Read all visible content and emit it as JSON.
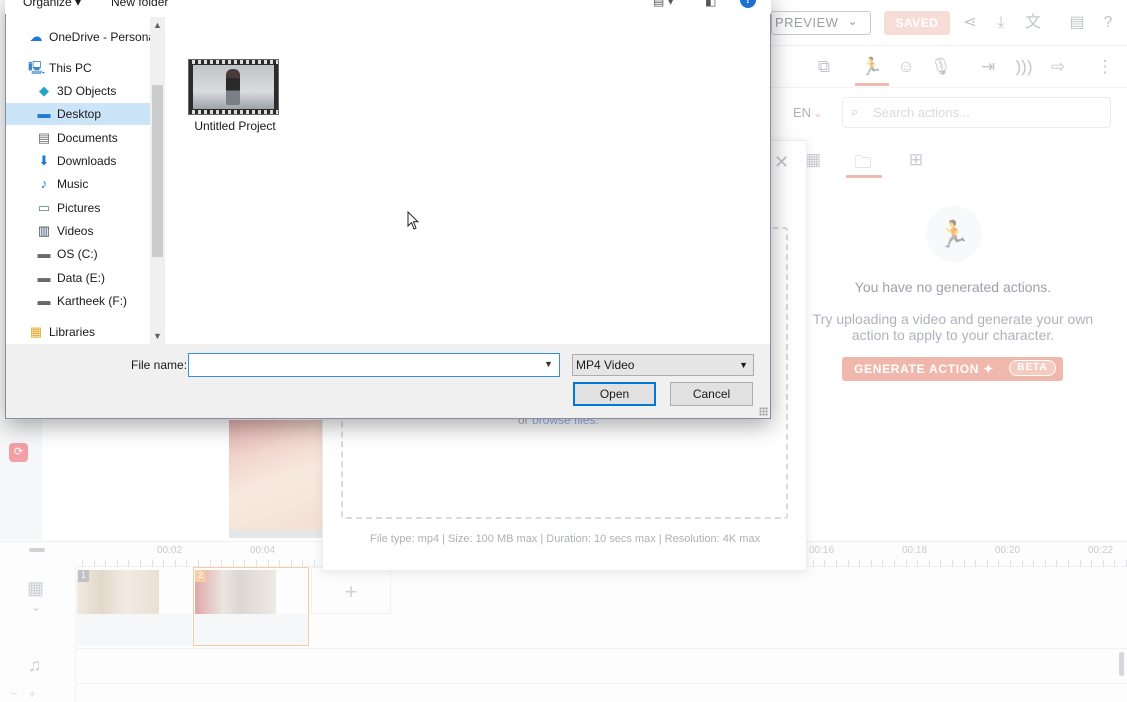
{
  "app": {
    "topbar": {
      "preview_label": "PREVIEW",
      "saved_label": "SAVED"
    },
    "actions_panel": {
      "language": "EN",
      "search_placeholder": "Search actions...",
      "empty_title": "You have no generated actions.",
      "empty_subtitle": "Try uploading a video and generate your own action to apply to your character.",
      "generate_label": "GENERATE ACTION",
      "beta_label": "BETA"
    },
    "upload_modal": {
      "browse_prefix": "or",
      "browse_link": "browse files.",
      "file_constraints": "File type: mp4 | Size: 100 MB max | Duration: 10 secs max | Resolution: 4K max"
    },
    "timeline": {
      "ruler_labels": [
        "00:02",
        "00:04",
        "00:16",
        "00:18",
        "00:20",
        "00:22"
      ],
      "clips": [
        {
          "number": "1"
        },
        {
          "number": "2"
        }
      ]
    }
  },
  "dialog": {
    "commands": {
      "organize": "Organize",
      "new_folder": "New folder"
    },
    "nav_items": [
      {
        "label": "OneDrive - Personal",
        "icon": "cloud-icon"
      },
      {
        "label": "This PC",
        "icon": "computer-icon"
      },
      {
        "label": "3D Objects",
        "icon": "cube-icon"
      },
      {
        "label": "Desktop",
        "icon": "desktop-icon",
        "selected": true
      },
      {
        "label": "Documents",
        "icon": "document-icon"
      },
      {
        "label": "Downloads",
        "icon": "download-arrow-icon"
      },
      {
        "label": "Music",
        "icon": "music-note-icon"
      },
      {
        "label": "Pictures",
        "icon": "picture-icon"
      },
      {
        "label": "Videos",
        "icon": "film-icon"
      },
      {
        "label": "OS (C:)",
        "icon": "drive-icon"
      },
      {
        "label": "Data (E:)",
        "icon": "drive-icon"
      },
      {
        "label": "Kartheek  (F:)",
        "icon": "drive-icon"
      },
      {
        "label": "Libraries",
        "icon": "library-icon"
      }
    ],
    "files": [
      {
        "name": "Untitled Project",
        "type": "video"
      }
    ],
    "file_name_label": "File name:",
    "file_name_value": "",
    "file_type": "MP4 Video",
    "open_label": "Open",
    "cancel_label": "Cancel"
  },
  "colors": {
    "accent": "#e47e68",
    "selection": "#cce4f7",
    "win_focus": "#0078d7"
  }
}
